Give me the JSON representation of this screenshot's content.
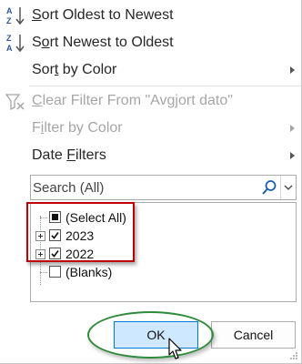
{
  "menu": {
    "sort_asc": {
      "pre": "",
      "key": "S",
      "post": "ort Oldest to Newest"
    },
    "sort_desc": {
      "pre": "S",
      "key": "o",
      "post": "rt Newest to Oldest"
    },
    "sort_color": {
      "pre": "Sor",
      "key": "t",
      "post": " by Color"
    },
    "clear_filter": {
      "pre": "",
      "key": "C",
      "post": "lear Filter From \"Avgjort dato\""
    },
    "filter_color": {
      "pre": "F",
      "key": "i",
      "post": "lter by Color"
    },
    "date_filters": {
      "pre": "Date ",
      "key": "F",
      "post": "ilters"
    }
  },
  "search": {
    "placeholder": "Search (All)"
  },
  "tree": {
    "items": [
      {
        "label": "(Select All)",
        "state": "partial"
      },
      {
        "label": "2023",
        "state": "checked"
      },
      {
        "label": "2022",
        "state": "checked"
      },
      {
        "label": "(Blanks)",
        "state": "unchecked"
      }
    ]
  },
  "buttons": {
    "ok": "OK",
    "cancel": "Cancel"
  },
  "icons": {
    "sort_asc": "sort-ascending-icon",
    "sort_desc": "sort-descending-icon",
    "clear_filter": "clear-filter-icon",
    "search": "search-icon",
    "dropdown": "chevron-down-icon",
    "submenu": "chevron-right-icon"
  },
  "colors": {
    "accent": "#0078d4",
    "ok_bg": "#cde8ff",
    "highlight_red": "#c00000",
    "highlight_green": "#2e8b3a"
  }
}
